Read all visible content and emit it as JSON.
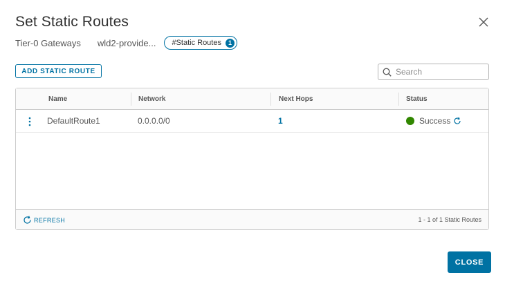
{
  "dialog": {
    "title": "Set Static Routes",
    "close_icon": "close-icon"
  },
  "subheader": {
    "context": "Tier-0 Gateways",
    "gateway": "wld2-provide...",
    "pill_label": "#Static Routes",
    "pill_count": "1"
  },
  "toolbar": {
    "add_label": "ADD STATIC ROUTE",
    "search_placeholder": "Search",
    "search_icon": "search-icon"
  },
  "table": {
    "columns": [
      "Name",
      "Network",
      "Next Hops",
      "Status"
    ],
    "rows": [
      {
        "name": "DefaultRoute1",
        "network": "0.0.0.0/0",
        "next_hops": "1",
        "status": "Success",
        "status_color": "#318700"
      }
    ]
  },
  "footer": {
    "refresh_label": "REFRESH",
    "pager_text": "1 - 1 of 1 Static Routes"
  },
  "actions": {
    "close_label": "CLOSE"
  },
  "colors": {
    "accent": "#0072a3",
    "success": "#318700"
  }
}
